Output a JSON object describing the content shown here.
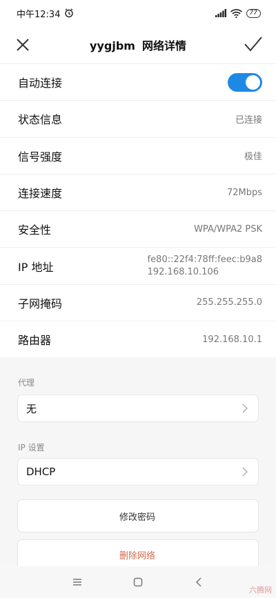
{
  "status": {
    "time": "中午12:34",
    "battery": "77"
  },
  "header": {
    "ssid": "yygjbm",
    "title": "网络详情"
  },
  "rows": [
    {
      "label": "自动连接",
      "toggle_on": true
    },
    {
      "label": "状态信息",
      "value": "已连接"
    },
    {
      "label": "信号强度",
      "value": "极佳"
    },
    {
      "label": "连接速度",
      "value": "72Mbps"
    },
    {
      "label": "安全性",
      "value": "WPA/WPA2 PSK"
    },
    {
      "label": "IP 地址",
      "value_line1": "fe80::22f4:78ff:feec:b9a8",
      "value_line2": "192.168.10.106"
    },
    {
      "label": "子网掩码",
      "value": "255.255.255.0"
    },
    {
      "label": "路由器",
      "value": "192.168.10.1"
    }
  ],
  "proxy": {
    "section": "代理",
    "value": "无"
  },
  "ip_settings": {
    "section": "IP 设置",
    "value": "DHCP"
  },
  "actions": {
    "change_password": "修改密码",
    "delete_network": "删除网络"
  },
  "watermark": "六腾网"
}
